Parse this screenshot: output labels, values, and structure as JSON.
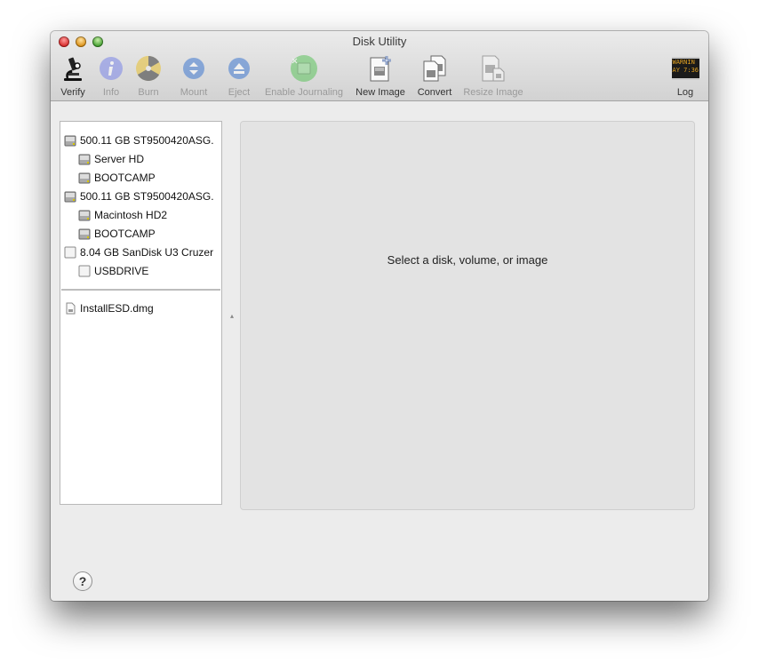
{
  "window": {
    "title": "Disk Utility",
    "controls": [
      "close",
      "minimize",
      "zoom"
    ]
  },
  "toolbar": {
    "items": [
      {
        "label": "Verify",
        "icon": "microscope-icon",
        "enabled": true
      },
      {
        "label": "Info",
        "icon": "info-icon",
        "enabled": false
      },
      {
        "label": "Burn",
        "icon": "burn-icon",
        "enabled": false
      },
      {
        "label": "Mount",
        "icon": "mount-icon",
        "enabled": false
      },
      {
        "label": "Eject",
        "icon": "eject-icon",
        "enabled": false
      },
      {
        "label": "Enable Journaling",
        "icon": "journaling-icon",
        "enabled": false
      },
      {
        "label": "New Image",
        "icon": "new-image-icon",
        "enabled": true
      },
      {
        "label": "Convert",
        "icon": "convert-icon",
        "enabled": true
      },
      {
        "label": "Resize Image",
        "icon": "resize-image-icon",
        "enabled": false
      },
      {
        "label": "Log",
        "icon": "log-icon",
        "enabled": true,
        "icon_text": [
          "WARNIN",
          "AY 7:36"
        ]
      }
    ]
  },
  "sidebar": {
    "disks": [
      {
        "label": "500.11 GB ST9500420ASG.",
        "type": "internal-disk",
        "level": 0
      },
      {
        "label": "Server HD",
        "type": "internal-volume",
        "level": 1
      },
      {
        "label": "BOOTCAMP",
        "type": "internal-volume",
        "level": 1
      },
      {
        "label": "500.11 GB ST9500420ASG.",
        "type": "internal-disk",
        "level": 0
      },
      {
        "label": "Macintosh HD2",
        "type": "internal-volume",
        "level": 1
      },
      {
        "label": "BOOTCAMP",
        "type": "internal-volume",
        "level": 1
      },
      {
        "label": "8.04 GB SanDisk U3 Cruzer",
        "type": "external-disk",
        "level": 0
      },
      {
        "label": "USBDRIVE",
        "type": "external-volume",
        "level": 1
      }
    ],
    "images": [
      {
        "label": "InstallESD.dmg",
        "type": "disk-image",
        "level": 0
      }
    ]
  },
  "detail": {
    "message": "Select a disk, volume, or image"
  },
  "footer": {
    "help_label": "?"
  }
}
